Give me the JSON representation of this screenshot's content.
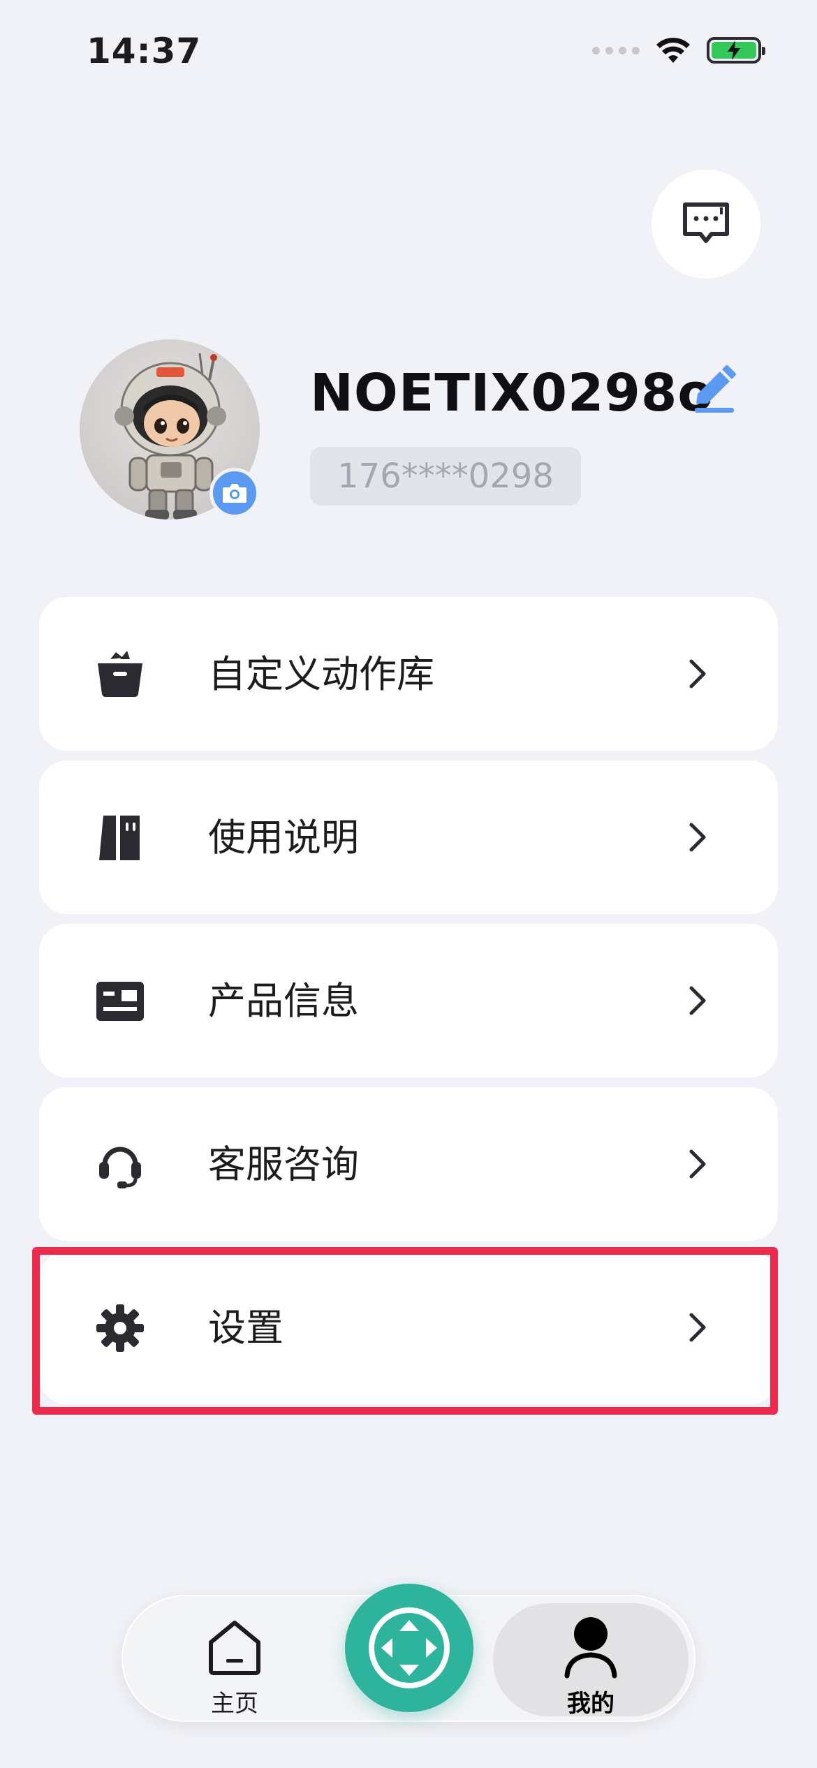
{
  "status_bar": {
    "time": "14:37",
    "battery_color": "#34c759"
  },
  "header": {
    "message_icon": "message-dots-icon"
  },
  "profile": {
    "username": "NOETIX0298o",
    "phone": "176****0298",
    "avatar_icon": "astronaut-avatar",
    "camera_icon": "camera-icon",
    "edit_icon": "pencil-icon",
    "accent_color": "#5b9af0"
  },
  "menu": {
    "items": [
      {
        "label": "自定义动作库",
        "icon": "bag-icon"
      },
      {
        "label": "使用说明",
        "icon": "book-icon"
      },
      {
        "label": "产品信息",
        "icon": "id-card-icon"
      },
      {
        "label": "客服咨询",
        "icon": "headset-icon"
      },
      {
        "label": "设置",
        "icon": "gear-icon"
      }
    ],
    "highlight_color": "#ec2a4b"
  },
  "tabbar": {
    "home_label": "主页",
    "mine_label": "我的",
    "center_color": "#2eb39d"
  }
}
